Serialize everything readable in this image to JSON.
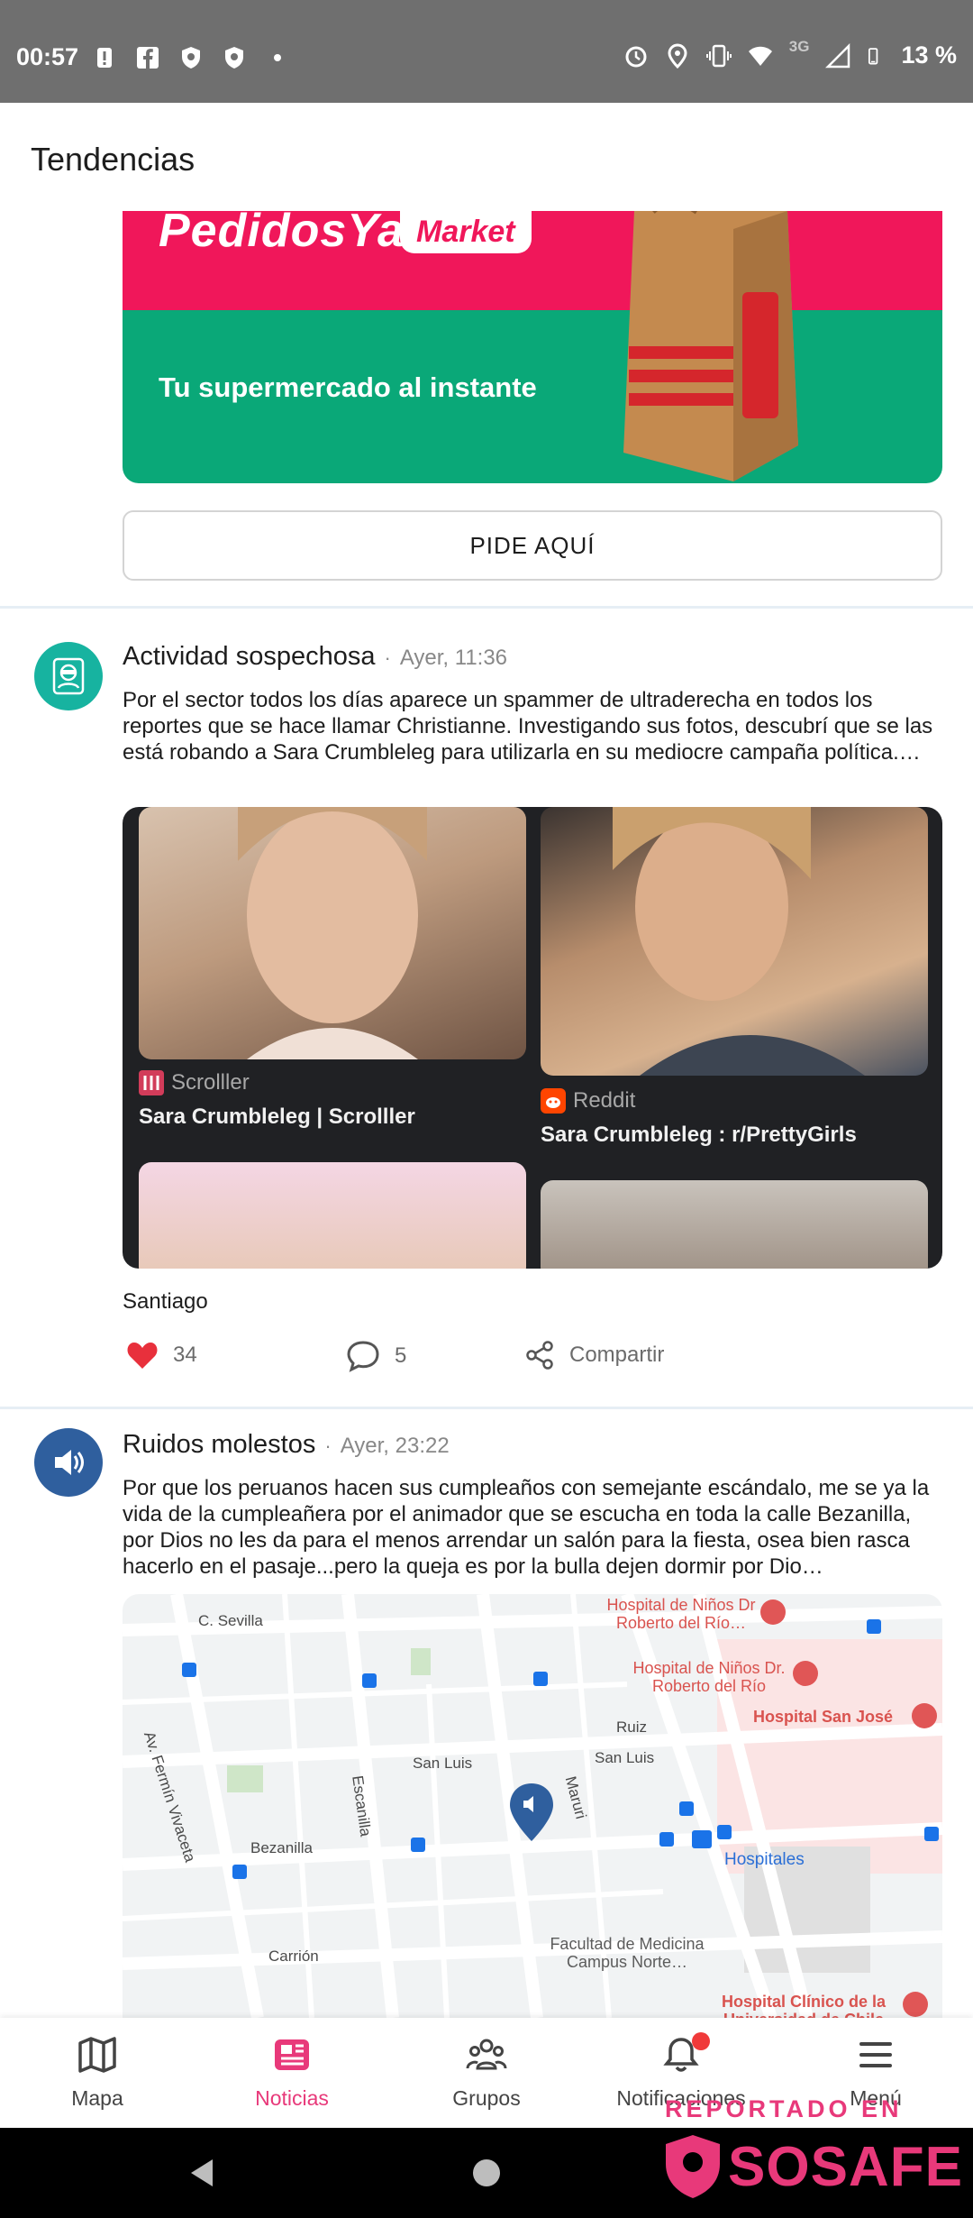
{
  "status_bar": {
    "time": "00:57",
    "battery": "13 %",
    "network": "3G",
    "left_icons": [
      "alert-icon",
      "facebook-icon",
      "shield-icon",
      "shield-icon",
      "dot-icon"
    ],
    "right_icons": [
      "alarm-icon",
      "location-icon",
      "vibrate-icon",
      "wifi-icon",
      "signal-icon",
      "battery-icon"
    ]
  },
  "header": {
    "title": "Tendencias"
  },
  "ad": {
    "brand": "PedidosYa",
    "badge": "Market",
    "tagline": "Tu supermercado al instante",
    "cta": "PIDE AQUÍ",
    "colors": {
      "top": "#f0175a",
      "bottom": "#0aa878"
    }
  },
  "posts": [
    {
      "category": "Actividad sospechosa",
      "time": "Ayer, 11:36",
      "avatar_icon": "user-incognito-icon",
      "avatar_color": "#17b3a0",
      "body": "Por el sector todos los días aparece un spammer de ultraderecha en todos los reportes que se hace llamar Christianne. Investigando sus fotos, descubrí que se las está robando a Sara Crumbleleg para utilizarla en su mediocre campaña política.…",
      "image_results": [
        {
          "source": "Scrolller",
          "title": "Sara Crumbleleg | Scrolller"
        },
        {
          "source": "Reddit",
          "title": "Sara Crumbleleg : r/PrettyGirls"
        }
      ],
      "location": "Santiago",
      "likes": "34",
      "comments": "5",
      "share_label": "Compartir"
    },
    {
      "category": "Ruidos molestos",
      "time": "Ayer, 23:22",
      "avatar_icon": "speaker-icon",
      "avatar_color": "#2f5f9e",
      "body": "Por que los peruanos hacen sus cumpleaños con semejante escándalo, me se ya la vida de la cumpleañera por el animador que se escucha en toda la calle Bezanilla, por Dios no les da para el menos arrendar un salón para la fiesta,  osea bien rasca hacerlo en el pasaje...pero la queja es por la bulla dejen dormir por Dio…",
      "map": {
        "streets": [
          "C. Sevilla",
          "Av. Fermín Vivaceta",
          "Escanilla",
          "San Luis",
          "San Luis",
          "Ruiz",
          "Maruri",
          "Bezanilla",
          "Carrión",
          "Hospitales"
        ],
        "pois": [
          "Hospital de Niños Dr Roberto del Río…",
          "Hospital de Niños Dr. Roberto del Río",
          "Hospital San José",
          "Facultad de Medicina Campus Norte…",
          "Hospital Clínico de la Universidad de Chile"
        ]
      }
    }
  ],
  "bottom_nav": [
    {
      "label": "Mapa",
      "icon": "map-icon",
      "active": false
    },
    {
      "label": "Noticias",
      "icon": "news-icon",
      "active": true
    },
    {
      "label": "Grupos",
      "icon": "groups-icon",
      "active": false
    },
    {
      "label": "Notificaciones",
      "icon": "bell-icon",
      "active": false
    },
    {
      "label": "Menú",
      "icon": "menu-icon",
      "active": false
    }
  ],
  "watermark": {
    "line1": "REPORTADO EN",
    "logo": "SOSAFE"
  },
  "accent_color": "#e8397a"
}
